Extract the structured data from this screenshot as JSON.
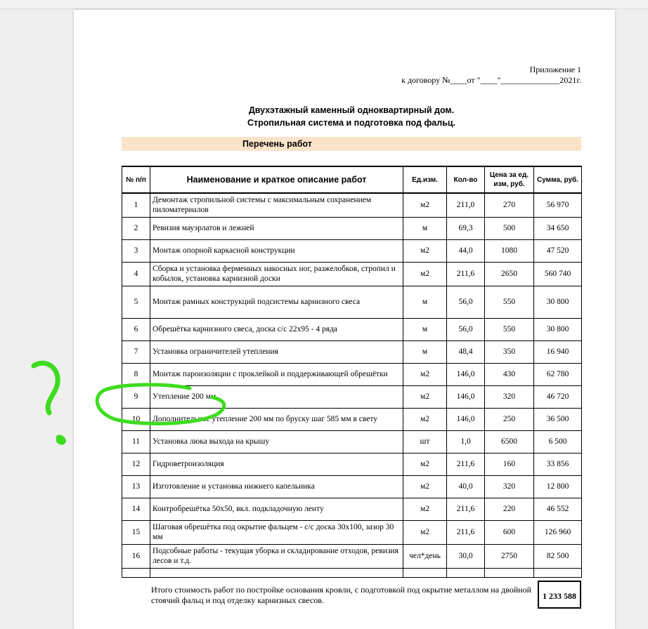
{
  "header": {
    "appendix_line1": "Приложение 1",
    "appendix_line2": "к договору №____от \"____\"______________2021г."
  },
  "title": {
    "line1": "Двухэтажный каменный одноквартирный дом.",
    "line2": "Стропильная система и подготовка под фальц."
  },
  "section_label": "Перечень работ",
  "table": {
    "headers": {
      "num": "№ п/п",
      "name": "Наименование и краткое описание работ",
      "unit": "Ед.изм.",
      "qty": "Кол-во",
      "price": "Цена за ед. изм, руб.",
      "sum": "Сумма, руб."
    },
    "rows": [
      {
        "n": "1",
        "name": "Демонтаж стропильной системы с максимальным сохранением пиломатериалов",
        "unit": "м2",
        "qty": "211,0",
        "price": "270",
        "sum": "56 970"
      },
      {
        "n": "2",
        "name": "Ревизия мауэрлатов и лежней",
        "unit": "м",
        "qty": "69,3",
        "price": "500",
        "sum": "34 650"
      },
      {
        "n": "3",
        "name": "Монтаж опорной каркасной конструкции",
        "unit": "м2",
        "qty": "44,0",
        "price": "1080",
        "sum": "47 520"
      },
      {
        "n": "4",
        "name": "Сборка и установка ферменных накосных ног, разжелобков, стропил и кобылок, установка карнизной доски",
        "unit": "м2",
        "qty": "211,6",
        "price": "2650",
        "sum": "560 740"
      },
      {
        "n": "5",
        "name": "Монтаж рамных конструкций подсистемы карнизного свеса",
        "unit": "м",
        "qty": "56,0",
        "price": "550",
        "sum": "30 800"
      },
      {
        "n": "6",
        "name": "Обрешётка карнизного свеса, доска с/с  22х95 - 4 ряда",
        "unit": "м",
        "qty": "56,0",
        "price": "550",
        "sum": "30 800"
      },
      {
        "n": "7",
        "name": "Установка ограничителей утепления",
        "unit": "м",
        "qty": "48,4",
        "price": "350",
        "sum": "16 940"
      },
      {
        "n": "8",
        "name": "Монтаж пароизоляции с проклейкой и поддерживающей обрешётки",
        "unit": "м2",
        "qty": "146,0",
        "price": "430",
        "sum": "62 780"
      },
      {
        "n": "9",
        "name": "Утепление 200 мм",
        "unit": "м2",
        "qty": "146,0",
        "price": "320",
        "sum": "46 720"
      },
      {
        "n": "10",
        "name": "Дополнительное утепление 200 мм по бруску шаг 585 мм в свету",
        "unit": "м2",
        "qty": "146,0",
        "price": "250",
        "sum": "36 500"
      },
      {
        "n": "11",
        "name": "Установка люка выхода на крышу",
        "unit": "шт",
        "qty": "1,0",
        "price": "6500",
        "sum": "6 500"
      },
      {
        "n": "12",
        "name": "Гидроветроизоляция",
        "unit": "м2",
        "qty": "211,6",
        "price": "160",
        "sum": "33 856"
      },
      {
        "n": "13",
        "name": "Изготовление и установка нижнего капельника",
        "unit": "м2",
        "qty": "40,0",
        "price": "320",
        "sum": "12 800"
      },
      {
        "n": "14",
        "name": "Контробрешётка 50х50, вкл. подкладочную ленту",
        "unit": "м2",
        "qty": "211,6",
        "price": "220",
        "sum": "46 552"
      },
      {
        "n": "15",
        "name": "Шаговая обрешётка под окрытие фальцем - с/с доска 30х100, зазор 30 мм",
        "unit": "м2",
        "qty": "211,6",
        "price": "600",
        "sum": "126 960"
      },
      {
        "n": "16",
        "name": "Подсобные работы - текущая уборка и складирование отходов, ревизия лесов и т.д.",
        "unit": "чел*день",
        "qty": "30,0",
        "price": "2750",
        "sum": "82 500"
      }
    ]
  },
  "total": {
    "text": "Итого стоимость работ по постройке основания кровли, с подготовкой под окрытие металлом на двойной стоячий фальц и под отделку карнизных свесов.",
    "sum": "1 233 588"
  },
  "annotation": {
    "color": "#3ddc1f",
    "mark": "question-mark-and-circle"
  }
}
